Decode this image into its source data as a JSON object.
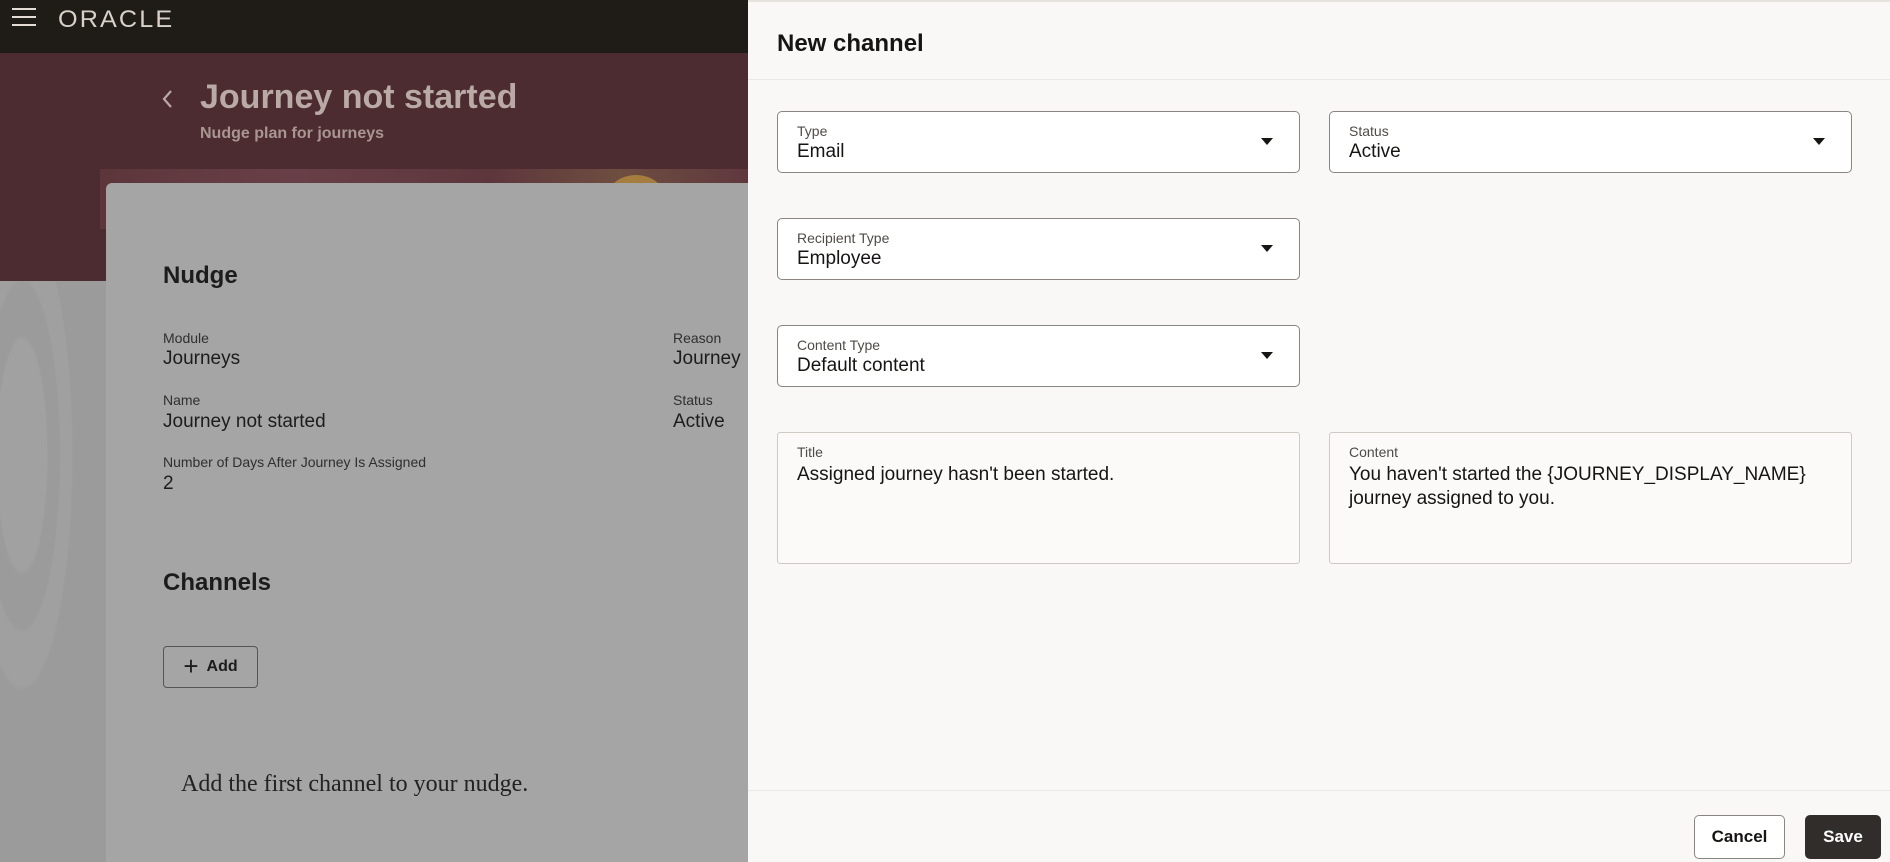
{
  "app": {
    "logo": "ORACLE"
  },
  "page": {
    "title": "Journey not started",
    "subtitle": "Nudge plan for journeys"
  },
  "nudge": {
    "heading": "Nudge",
    "fields": {
      "module_label": "Module",
      "module_value": "Journeys",
      "reason_label": "Reason",
      "reason_value": "Journey",
      "name_label": "Name",
      "name_value": "Journey not started",
      "status_label": "Status",
      "status_value": "Active",
      "days_label": "Number of Days After Journey Is Assigned",
      "days_value": "2"
    }
  },
  "channels": {
    "heading": "Channels",
    "add_label": "Add",
    "empty_message": "Add the first channel to your nudge."
  },
  "drawer": {
    "title": "New channel",
    "type": {
      "label": "Type",
      "value": "Email"
    },
    "status": {
      "label": "Status",
      "value": "Active"
    },
    "recipient_type": {
      "label": "Recipient Type",
      "value": "Employee"
    },
    "content_type": {
      "label": "Content Type",
      "value": "Default content"
    },
    "title_field": {
      "label": "Title",
      "value": "Assigned journey hasn't been started."
    },
    "content_field": {
      "label": "Content",
      "value": "You haven't started the {JOURNEY_DISPLAY_NAME} journey assigned to you."
    },
    "cancel_label": "Cancel",
    "save_label": "Save"
  },
  "icons": {
    "menu": "hamburger-menu-icon",
    "back": "chevron-left-icon",
    "add": "plus-icon",
    "dropdown": "caret-down-icon"
  },
  "colors": {
    "topbar": "#1f1b17",
    "hero": "#4c2b31",
    "overlay": "#9d9d9d",
    "drawer_bg": "#f9f8f6",
    "primary_button": "#312d2a"
  }
}
